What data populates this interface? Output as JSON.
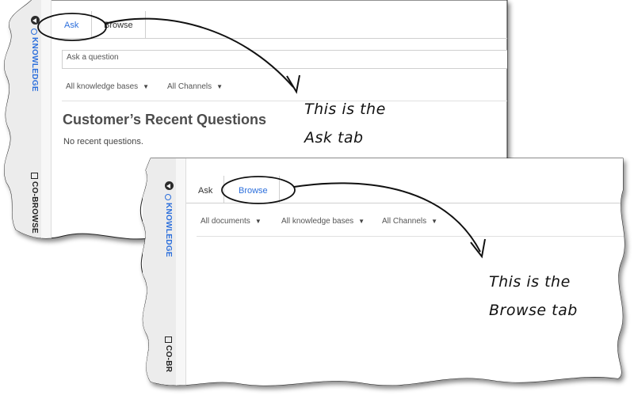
{
  "ask_panel": {
    "tabs": [
      {
        "label": "Ask"
      },
      {
        "label": "Browse"
      }
    ],
    "search": {
      "placeholder": "Ask a question"
    },
    "filters": [
      {
        "label": "All knowledge bases"
      },
      {
        "label": "All Channels"
      }
    ],
    "heading": "Customer’s Recent Questions",
    "empty_text": "No recent questions.",
    "sidebar": {
      "knowledge_label": "KNOWLEDGE",
      "cobrowse_label": "CO-BROWSE"
    }
  },
  "browse_panel": {
    "tabs": [
      {
        "label": "Ask"
      },
      {
        "label": "Browse"
      }
    ],
    "filters": [
      {
        "label": "All documents"
      },
      {
        "label": "All knowledge bases"
      },
      {
        "label": "All Channels"
      }
    ],
    "sidebar": {
      "knowledge_label": "KNOWLEDGE",
      "cobrowse_label": "CO-BR"
    }
  },
  "annotations": {
    "ask": {
      "line1": "This is the",
      "line2": "Ask tab"
    },
    "browse": {
      "line1": "This is the",
      "line2": "Browse tab"
    }
  },
  "colors": {
    "accent": "#2c6fdc",
    "sidebar": "#ececec",
    "border": "#cfcfcf"
  }
}
